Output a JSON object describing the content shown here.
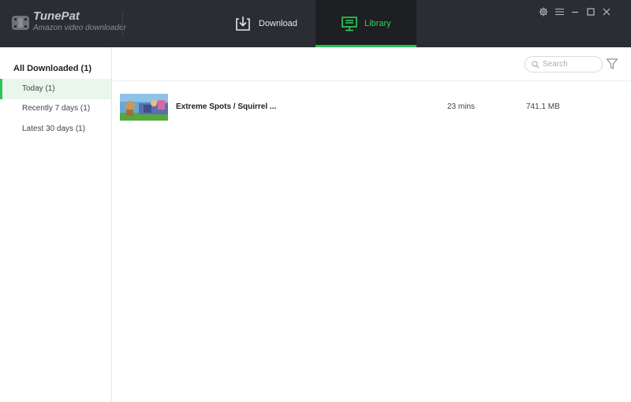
{
  "app": {
    "name": "TunePat",
    "subtitle": "Amazon video downloader"
  },
  "tabs": [
    {
      "label": "Download",
      "icon": "download-icon",
      "active": false
    },
    {
      "label": "Library",
      "icon": "monitor-icon",
      "active": true
    }
  ],
  "window_controls": [
    "gear-icon",
    "menu-icon",
    "minimize-icon",
    "maximize-icon",
    "close-icon"
  ],
  "sidebar": {
    "title": "All Downloaded (1)",
    "items": [
      {
        "label": "Today (1)",
        "active": true
      },
      {
        "label": "Recently 7 days (1)",
        "active": false
      },
      {
        "label": "Latest 30 days (1)",
        "active": false
      }
    ]
  },
  "search": {
    "placeholder": "Search",
    "value": ""
  },
  "videos": [
    {
      "title": "Extreme Spots / Squirrel ...",
      "duration": "23 mins",
      "size": "741.1 MB"
    }
  ],
  "colors": {
    "titlebar": "#2a2d33",
    "accent": "#2cc45a",
    "active_tab_bg": "#1d1f23"
  }
}
